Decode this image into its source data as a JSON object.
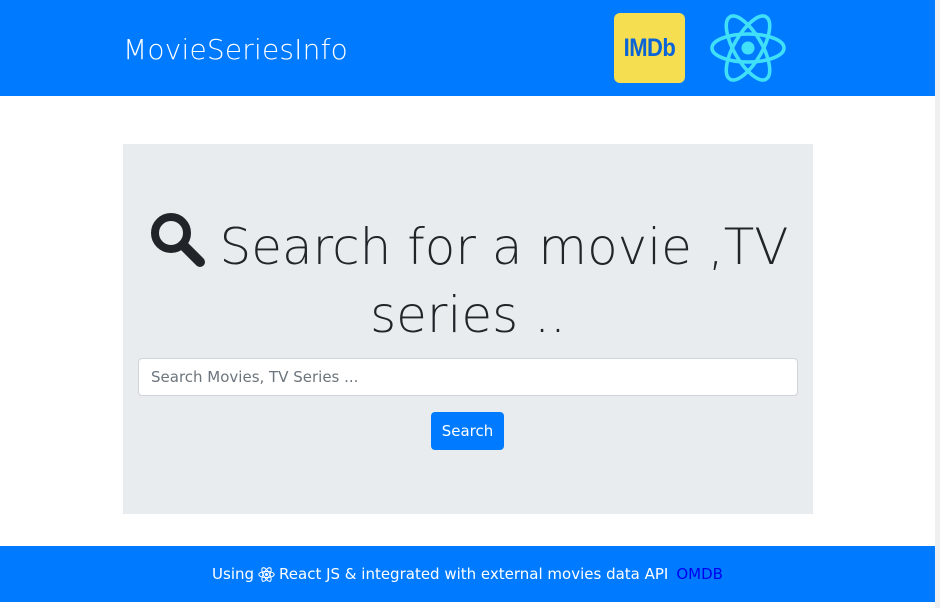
{
  "navbar": {
    "brand": "MovieSeriesInfo",
    "imdb_logo_text": "IMDb",
    "react_icon": "react-atom-icon",
    "imdb_color": "#f5de50",
    "bg_color": "#007bff"
  },
  "jumbotron": {
    "headline_icon": "search-icon",
    "headline": "Search for a movie ,TV series ..",
    "search": {
      "placeholder": "Search Movies, TV Series ...",
      "value": ""
    },
    "search_button_label": "Search"
  },
  "footer": {
    "prefix": "Using",
    "react_icon": "react-atom-icon",
    "middle": "React JS & integrated with external movies data API",
    "link_label": "OMDB"
  }
}
